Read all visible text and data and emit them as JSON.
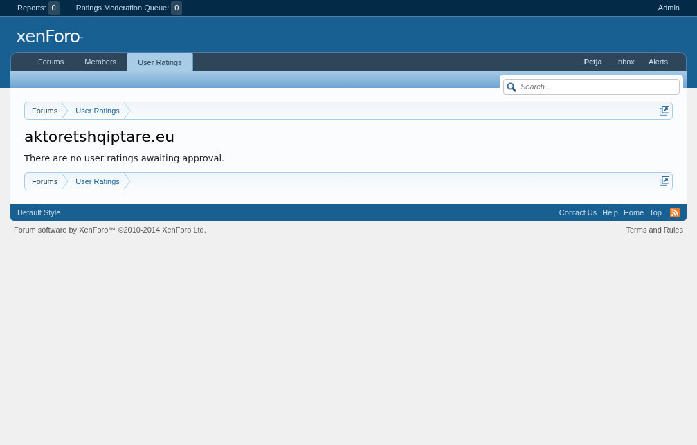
{
  "moderator_bar": {
    "items": [
      {
        "label": "Reports:",
        "count": "0"
      },
      {
        "label": "Ratings Moderation Queue:",
        "count": "0"
      }
    ],
    "account": "Admin"
  },
  "logo": {
    "text_light": "xen",
    "text_bold": "Foro",
    "mark": "™"
  },
  "nav": {
    "tabs": [
      {
        "label": "Forums",
        "selected": false
      },
      {
        "label": "Members",
        "selected": false
      },
      {
        "label": "User Ratings",
        "selected": true
      }
    ],
    "user_links": [
      "Petja",
      "Inbox",
      "Alerts"
    ]
  },
  "search": {
    "placeholder": "Search..."
  },
  "breadcrumb_top": [
    "Forums",
    "User Ratings"
  ],
  "title": "aktoretshqiptare.eu",
  "message": "There are no user ratings awaiting approval.",
  "breadcrumb_bottom": [
    "Forums",
    "User Ratings"
  ],
  "footer": {
    "style": "Default Style",
    "links": [
      "Contact Us",
      "Help",
      "Home",
      "Top"
    ]
  },
  "copyright": "Forum software by XenForo™ ©2010-2014 XenForo Ltd.",
  "terms": "Terms and Rules"
}
